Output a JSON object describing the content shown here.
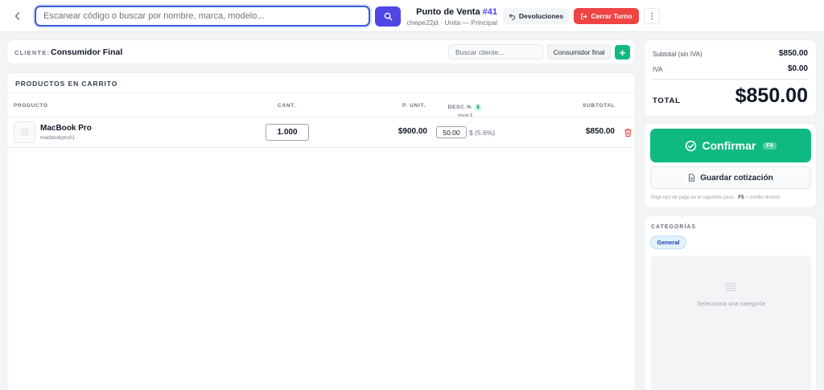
{
  "topbar": {
    "search_placeholder": "Escanear código o buscar por nombre, marca, modelo...",
    "pos_title": "Punto de Venta",
    "pos_number": "#41",
    "pos_subtitle": "chepe22jd · Unita — Principal",
    "devoluciones_label": "Devoluciones",
    "cerrar_turno_label": "Cerrar Turno"
  },
  "cliente": {
    "label": "CLIENTE:",
    "name": "Consumidor Final",
    "search_placeholder": "Buscar cliente...",
    "chip_label": "Consumidor final",
    "add_label": "+"
  },
  "cart": {
    "title": "PRODUCTOS EN CARRITO",
    "headers": {
      "producto": "PRODUCTO",
      "cant": "CANT.",
      "punit": "P. UNIT.",
      "desc": "DESC.%",
      "desc_badge": "$",
      "desc_sub": "monto $",
      "subtotal": "SUBTOTAL"
    },
    "items": [
      {
        "name": "MacBook Pro",
        "sku": "macbookpro01",
        "qty": "1.000",
        "unit_price": "$900.00",
        "discount": "50.00",
        "discount_meta": "$ (5.6%)",
        "subtotal": "$850.00"
      }
    ]
  },
  "totals": {
    "subtotal_label": "Subtotal (sin IVA)",
    "subtotal_value": "$850.00",
    "iva_label": "IVA",
    "iva_value": "$0.00",
    "total_label": "TOTAL",
    "total_value": "$850.00"
  },
  "actions": {
    "confirm_label": "Confirmar",
    "confirm_key": "F4",
    "quote_label": "Guardar cotización",
    "hint_prefix": "Elige tipo de pago en el siguiente paso ·",
    "hint_key": "F5",
    "hint_suffix": "= crédito directo"
  },
  "categories": {
    "title": "CATEGORÍAS",
    "chip_label": "General",
    "empty_text": "Selecciona una categoría"
  },
  "colors": {
    "primary": "#4f46e5",
    "danger": "#ef4444",
    "success": "#10b981",
    "background": "#f3f4f6"
  }
}
